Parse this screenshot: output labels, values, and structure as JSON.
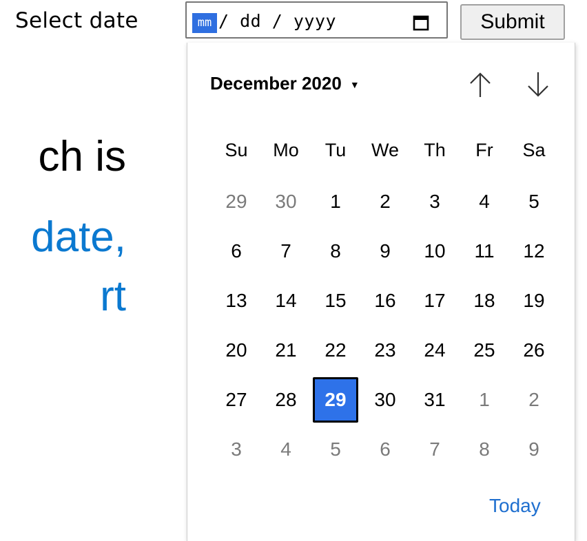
{
  "form": {
    "label": "Select date",
    "date_input": {
      "month_seg": "mm",
      "rest": "/ dd / yyyy"
    },
    "calendar_icon": "calendar-icon",
    "submit_label": "Submit"
  },
  "background_text": {
    "line1": "ch is",
    "line2": "date,",
    "line3": "rt"
  },
  "calendar": {
    "month_label": "December 2020",
    "weekdays": [
      "Su",
      "Mo",
      "Tu",
      "We",
      "Th",
      "Fr",
      "Sa"
    ],
    "weeks": [
      [
        {
          "d": "29",
          "o": true
        },
        {
          "d": "30",
          "o": true
        },
        {
          "d": "1"
        },
        {
          "d": "2"
        },
        {
          "d": "3"
        },
        {
          "d": "4"
        },
        {
          "d": "5"
        }
      ],
      [
        {
          "d": "6"
        },
        {
          "d": "7"
        },
        {
          "d": "8"
        },
        {
          "d": "9"
        },
        {
          "d": "10"
        },
        {
          "d": "11"
        },
        {
          "d": "12"
        }
      ],
      [
        {
          "d": "13"
        },
        {
          "d": "14"
        },
        {
          "d": "15"
        },
        {
          "d": "16"
        },
        {
          "d": "17"
        },
        {
          "d": "18"
        },
        {
          "d": "19"
        }
      ],
      [
        {
          "d": "20"
        },
        {
          "d": "21"
        },
        {
          "d": "22"
        },
        {
          "d": "23"
        },
        {
          "d": "24"
        },
        {
          "d": "25"
        },
        {
          "d": "26"
        }
      ],
      [
        {
          "d": "27"
        },
        {
          "d": "28"
        },
        {
          "d": "29",
          "s": true
        },
        {
          "d": "30"
        },
        {
          "d": "31"
        },
        {
          "d": "1",
          "o": true
        },
        {
          "d": "2",
          "o": true
        }
      ],
      [
        {
          "d": "3",
          "o": true
        },
        {
          "d": "4",
          "o": true
        },
        {
          "d": "5",
          "o": true
        },
        {
          "d": "6",
          "o": true
        },
        {
          "d": "7",
          "o": true
        },
        {
          "d": "8",
          "o": true
        },
        {
          "d": "9",
          "o": true
        }
      ]
    ],
    "today_label": "Today"
  },
  "colors": {
    "selected": "#2e72e9",
    "link": "#1f6fcf",
    "background_link_text": "#0b79d0"
  }
}
